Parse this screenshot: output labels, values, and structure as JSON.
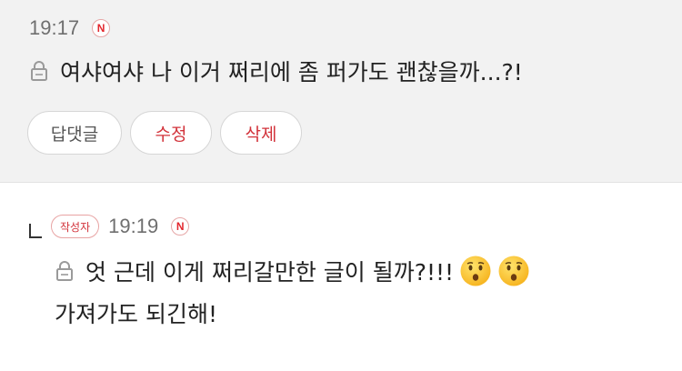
{
  "comment": {
    "time": "19:17",
    "source_badge": "N",
    "text": "여샤여샤 나 이거 쩌리에 좀 퍼가도 괜찮을까...?!",
    "private_icon": "lock-icon",
    "actions": {
      "reply_label": "답댓글",
      "edit_label": "수정",
      "delete_label": "삭제"
    }
  },
  "reply": {
    "author_badge": "작성자",
    "time": "19:19",
    "source_badge": "N",
    "private_icon": "lock-icon",
    "line1": "엇 근데 이게 쩌리갈만한 글이 될까?!!!",
    "emojis": [
      "hushed-face-icon",
      "hushed-face-icon"
    ],
    "line2": "가져가도 되긴해!"
  },
  "colors": {
    "accent_red": "#d2323a",
    "top_background": "#f2f2f2"
  }
}
